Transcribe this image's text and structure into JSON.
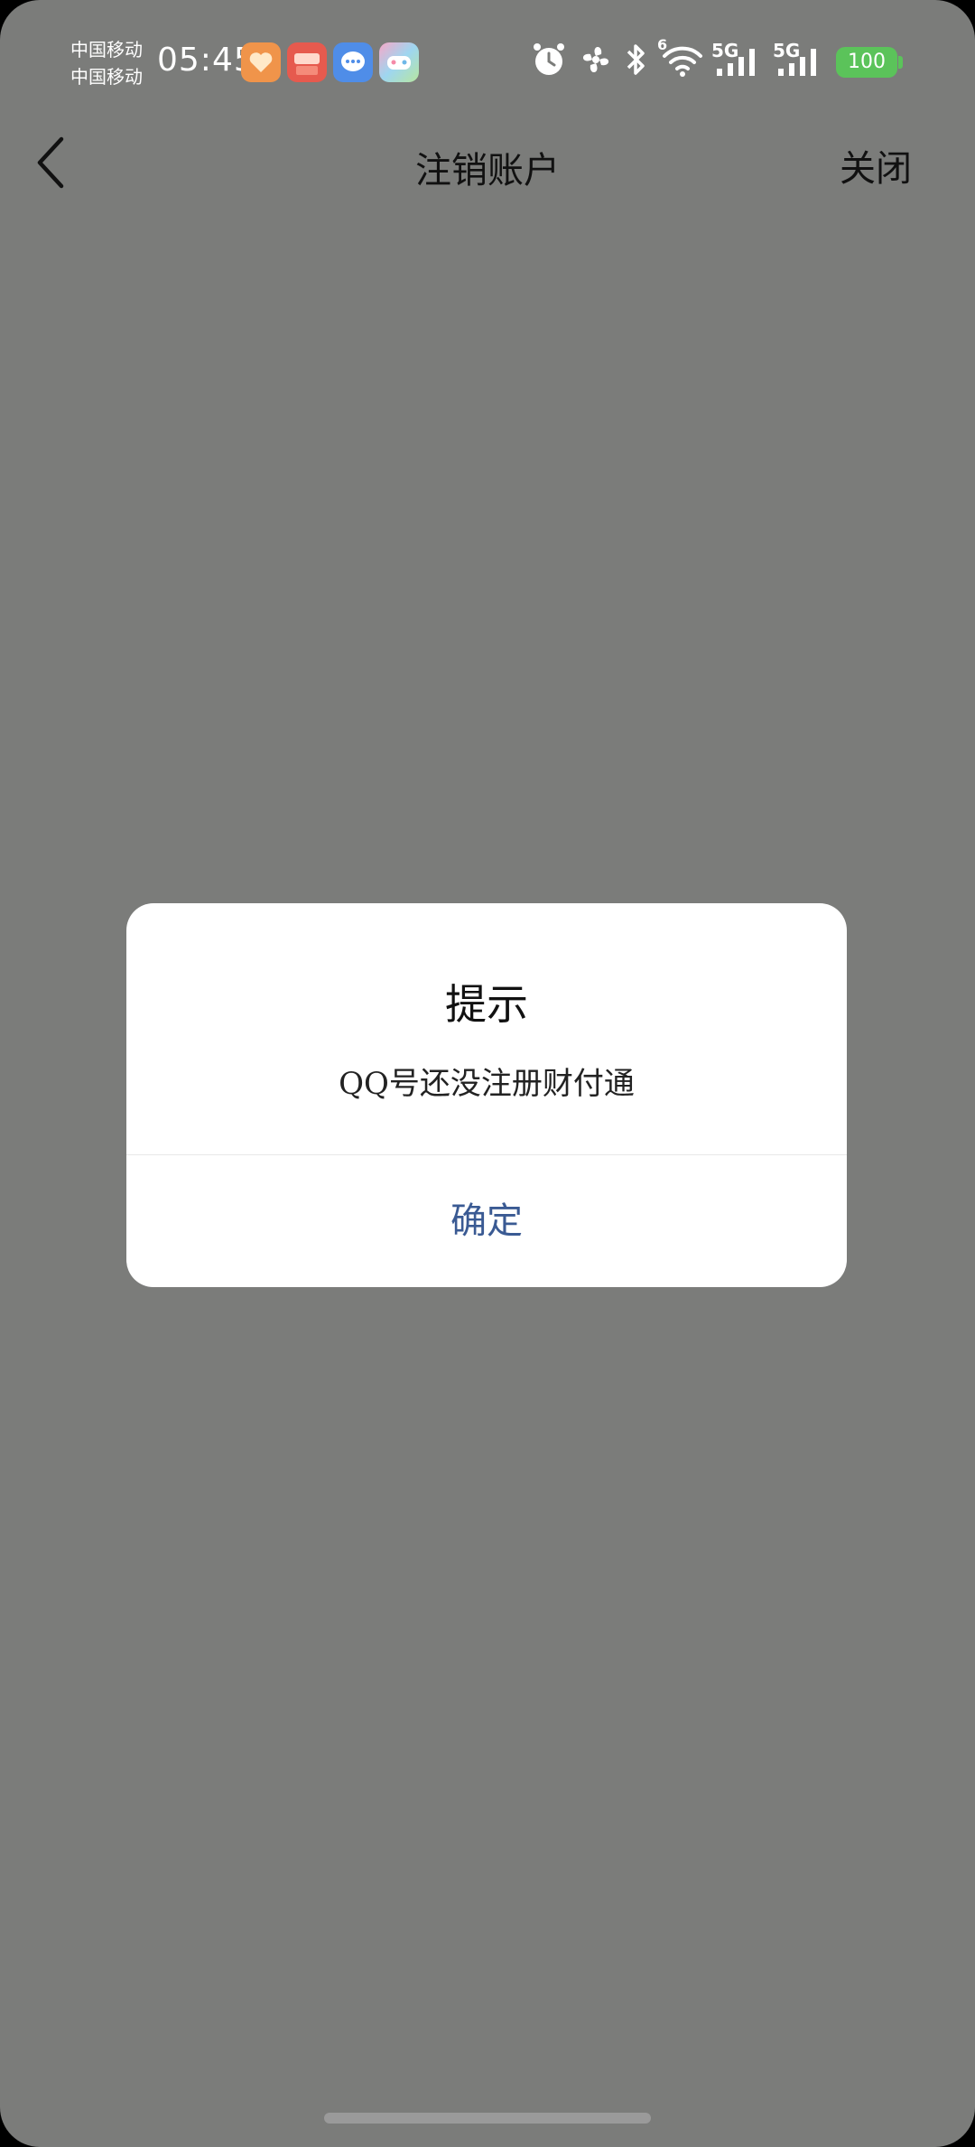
{
  "status_bar": {
    "carrier_1": "中国移动",
    "carrier_2": "中国移动",
    "time": "05:45",
    "net_label_1": "5G",
    "net_label_2": "5G",
    "wifi_badge": "6",
    "battery": "100",
    "app_icons": [
      "heart-app-icon",
      "gift-app-icon",
      "message-app-icon",
      "game-app-icon"
    ],
    "system_icons": [
      "alarm-icon",
      "fan-icon",
      "bluetooth-icon",
      "wifi-icon",
      "signal-icon",
      "signal-icon"
    ]
  },
  "nav": {
    "title": "注销账户",
    "close": "关闭"
  },
  "dialog": {
    "title": "提示",
    "message": "QQ号还没注册财付通",
    "confirm": "确定"
  },
  "colors": {
    "background_overlay": "#7b7c7a",
    "dialog_bg": "#ffffff",
    "confirm_text": "#3a5a93",
    "battery": "#5bc35a"
  }
}
